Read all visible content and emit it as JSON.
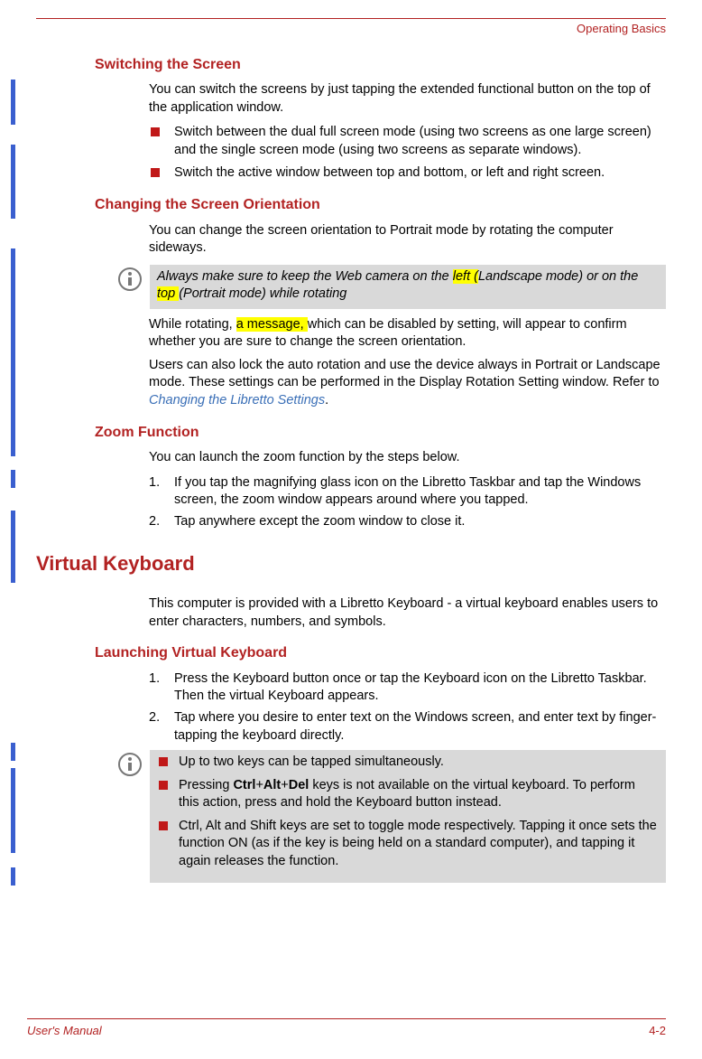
{
  "header": {
    "chapter": "Operating Basics"
  },
  "footer": {
    "left": "User's Manual",
    "right": "4-2"
  },
  "s1": {
    "title": "Switching the Screen",
    "p1": "You can switch the screens by just tapping the extended functional button on the top of the application window.",
    "b1": "Switch between the dual full screen mode (using two screens as one large screen) and the single screen mode (using two screens as separate windows).",
    "b2": "Switch the active window between top and bottom, or left and right screen."
  },
  "s2": {
    "title": "Changing the Screen Orientation",
    "p1": "You can change the screen orientation to Portrait mode by rotating the computer sideways.",
    "note_a": "Always make sure to keep the Web camera on the ",
    "note_hl1": "left (",
    "note_b": "Landscape mode) or on the",
    "note_hl2": " top ",
    "note_c": "(Portrait mode) while rotating",
    "p2a": "While rotating, ",
    "p2hl": "a message, ",
    "p2b": "which can be disabled by setting, will appear to confirm whether you are sure to change the screen orientation.",
    "p3a": "Users can also lock the auto rotation and use the device always in Portrait or Landscape mode. These settings can be performed in the Display Rotation Setting window. Refer to ",
    "p3link": "Changing the Libretto Settings",
    "p3b": "."
  },
  "s3": {
    "title": "Zoom Function",
    "p1": "You can launch the zoom function by the steps below.",
    "o1": "If you tap the magnifying glass icon on the Libretto Taskbar and tap the Windows screen, the zoom window appears around where you tapped.",
    "o2": "Tap anywhere except the zoom window to close it."
  },
  "s4": {
    "title": "Virtual Keyboard",
    "p1": "This computer is provided with a Libretto Keyboard - a virtual keyboard enables users to enter characters, numbers, and symbols."
  },
  "s5": {
    "title": "Launching Virtual Keyboard",
    "o1": "Press the Keyboard button once or tap the Keyboard icon on the Libretto Taskbar. Then the virtual Keyboard appears.",
    "o2": "Tap where you desire to enter text on the Windows screen, and enter text by finger-tapping the keyboard directly.",
    "nb1": "Up to two keys can be tapped simultaneously.",
    "nb2a": "Pressing ",
    "nb2k1": "Ctrl",
    "nb2p1": "+",
    "nb2k2": "Alt",
    "nb2p2": "+",
    "nb2k3": "Del",
    "nb2b": " keys is not available on the virtual keyboard. To perform this action, press and hold the Keyboard button instead.",
    "nb3": "Ctrl, Alt and Shift keys are set to toggle mode respectively. Tapping it once sets the function ON (as if the key is being held on a standard computer), and tapping it again releases the function."
  }
}
